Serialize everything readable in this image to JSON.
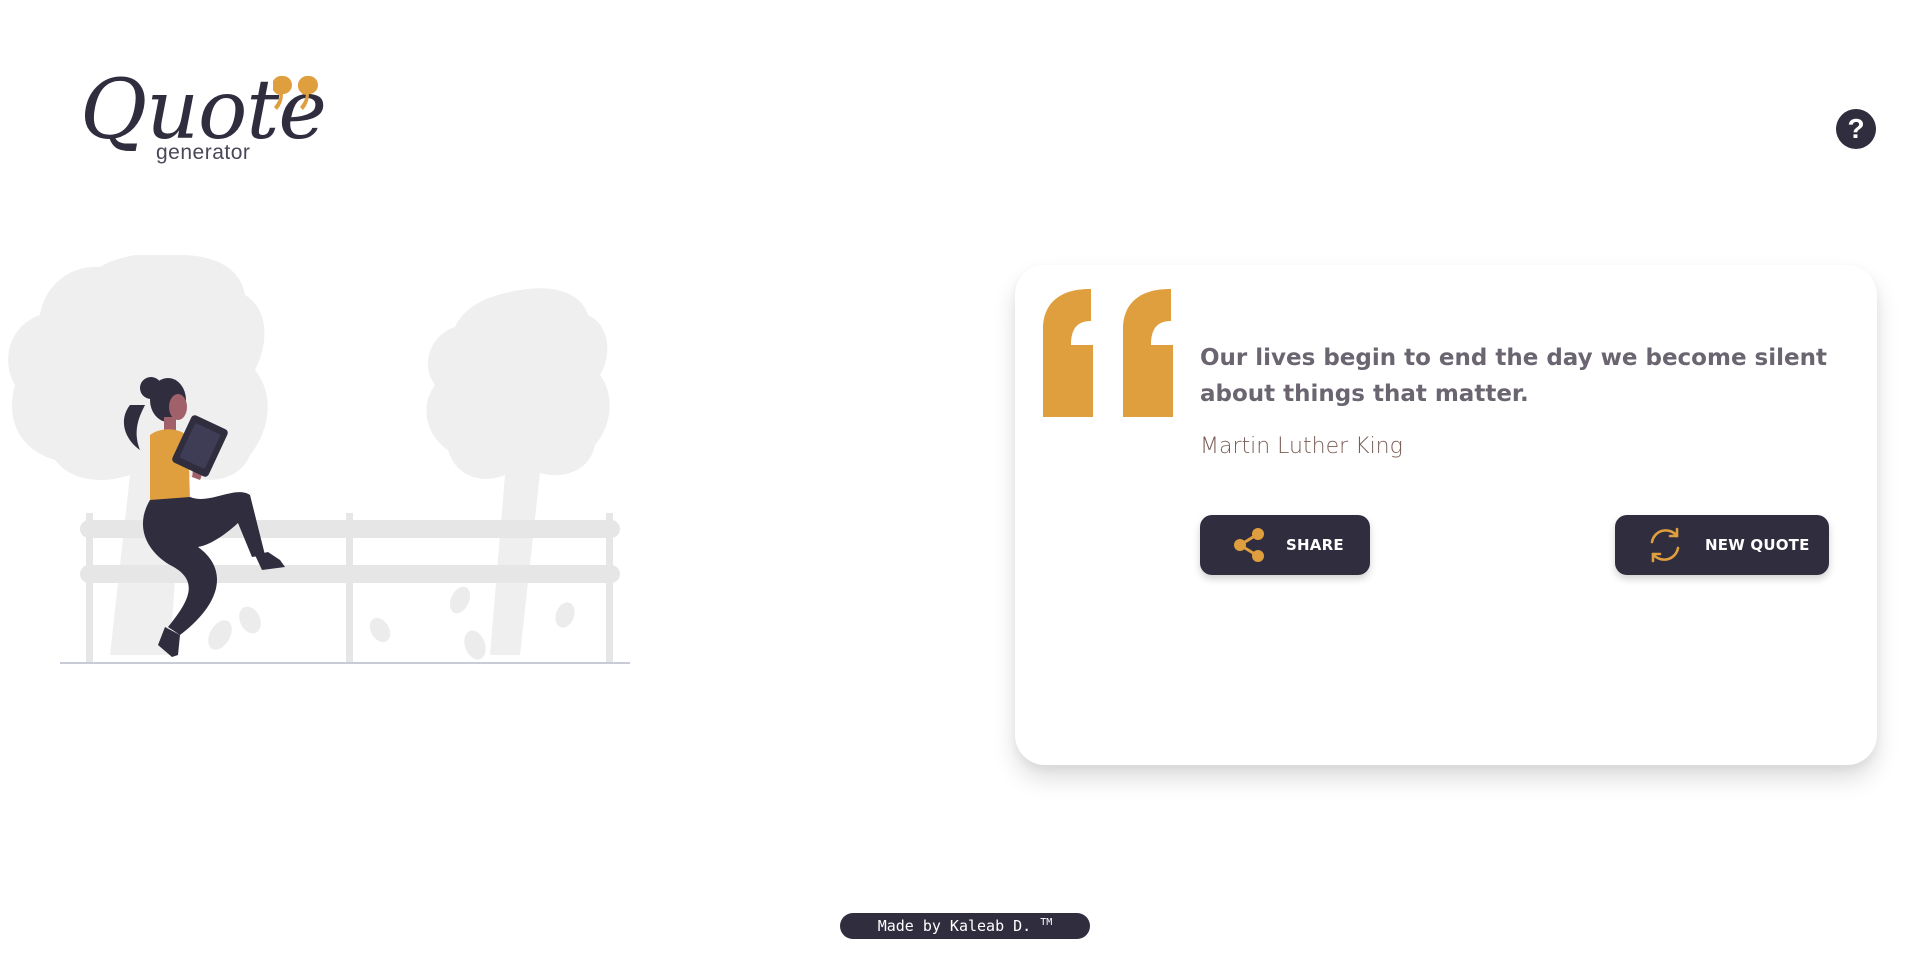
{
  "logo": {
    "word": "Quote",
    "sub": "generator"
  },
  "help": {
    "label": "?",
    "icon": "question-icon"
  },
  "quote": {
    "text": "Our lives begin to end the day we become silent about things that matter.",
    "author": "Martin Luther King"
  },
  "buttons": {
    "share": {
      "label": "SHARE",
      "icon": "share-icon"
    },
    "new_quote": {
      "label": "NEW QUOTE",
      "icon": "refresh-icon"
    }
  },
  "footer": {
    "text": "Made by Kaleab D.",
    "mark": "TM"
  },
  "colors": {
    "accent": "#e09f3e",
    "dark": "#2f2d3e",
    "quote_text": "#6a6570",
    "author_text": "#7a5c55"
  }
}
